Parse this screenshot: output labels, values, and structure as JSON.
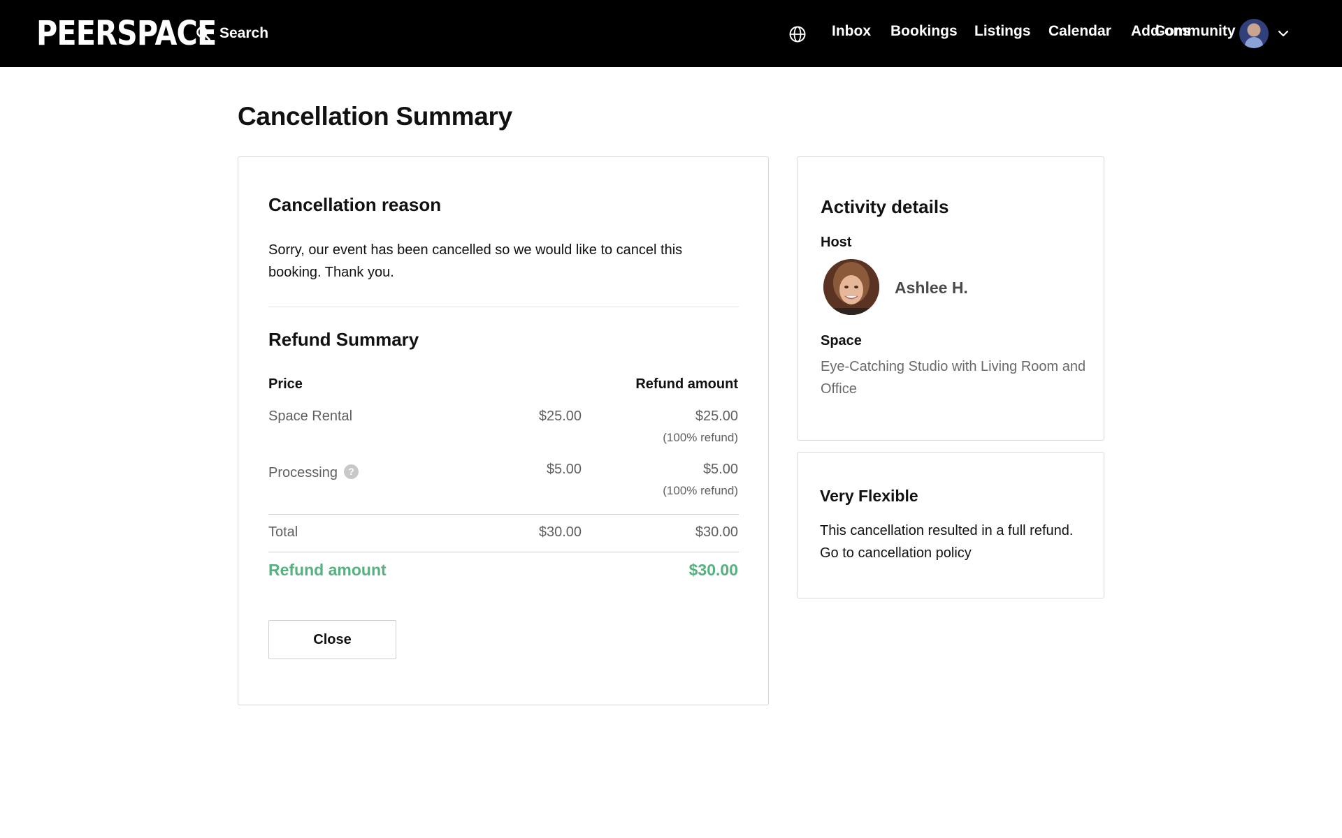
{
  "header": {
    "logo": "PEERSPACE",
    "search_label": "Search",
    "nav": {
      "inbox": "Inbox",
      "bookings": "Bookings",
      "listings": "Listings",
      "calendar": "Calendar",
      "addons": "Add-ons",
      "community": "Community"
    },
    "icons": [
      "search-icon",
      "globe-icon",
      "avatar",
      "chevron-down-icon"
    ]
  },
  "page": {
    "title": "Cancellation Summary"
  },
  "reason": {
    "heading": "Cancellation reason",
    "text": "Sorry, our event has been cancelled so we would like to cancel this booking. Thank you."
  },
  "refund": {
    "heading": "Refund Summary",
    "col_price": "Price",
    "col_refund": "Refund amount",
    "rows": [
      {
        "label": "Space Rental",
        "price": "$25.00",
        "refund": "$25.00",
        "note": "(100% refund)"
      },
      {
        "label": "Processing",
        "price": "$5.00",
        "refund": "$5.00",
        "note": "(100% refund)",
        "help_icon": "?"
      }
    ],
    "total": {
      "label": "Total",
      "price": "$30.00",
      "refund": "$30.00"
    },
    "refund_amount": {
      "label": "Refund amount",
      "value": "$30.00"
    },
    "close_label": "Close",
    "accent_color": "#55b17f"
  },
  "activity": {
    "heading": "Activity details",
    "host_label": "Host",
    "host_name": "Ashlee H.",
    "space_label": "Space",
    "space_name": "Eye-Catching Studio with Living Room and Office"
  },
  "policy": {
    "heading": "Very Flexible",
    "text": "This cancellation resulted in a full refund.",
    "link": "Go to cancellation policy"
  }
}
